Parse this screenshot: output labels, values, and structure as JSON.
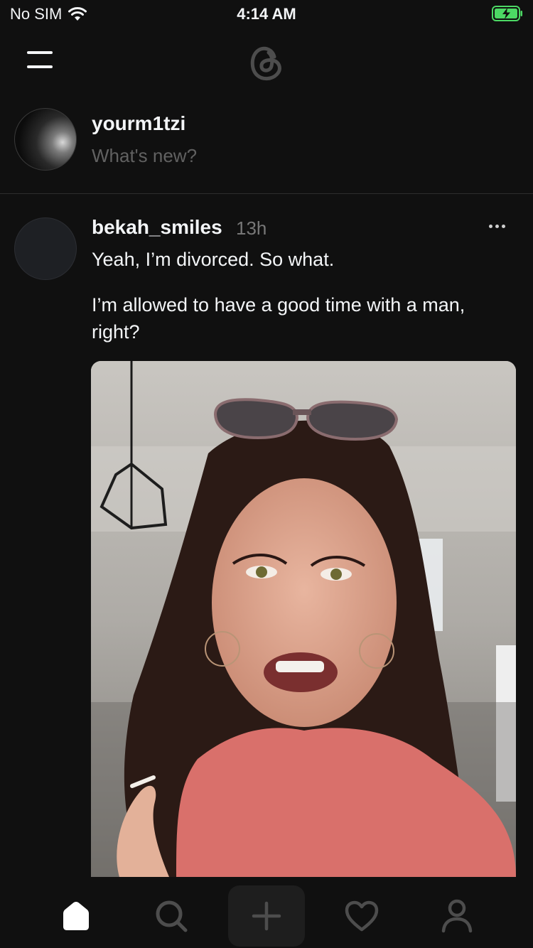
{
  "status": {
    "carrier": "No SIM",
    "time": "4:14 AM",
    "battery_color": "#4cd964"
  },
  "icons": {
    "wifi": "wifi-icon",
    "battery": "battery-charging-icon",
    "menu": "hamburger-menu-icon",
    "logo": "threads-logo-icon",
    "more": "more-dots-icon",
    "home": "home-icon",
    "search": "search-icon",
    "compose": "plus-icon",
    "activity": "heart-icon",
    "profile": "person-icon"
  },
  "composer": {
    "username": "yourm1tzi",
    "placeholder": "What's new?"
  },
  "post": {
    "username": "bekah_smiles",
    "time": "13h",
    "line1": "Yeah, I’m divorced. So what.",
    "line2": "I’m allowed to have a good time with a man, right?"
  },
  "colors": {
    "background": "#101010",
    "text_primary": "#f3f5f7",
    "text_secondary": "#616161",
    "accent_active_tab": "#ffffff"
  }
}
